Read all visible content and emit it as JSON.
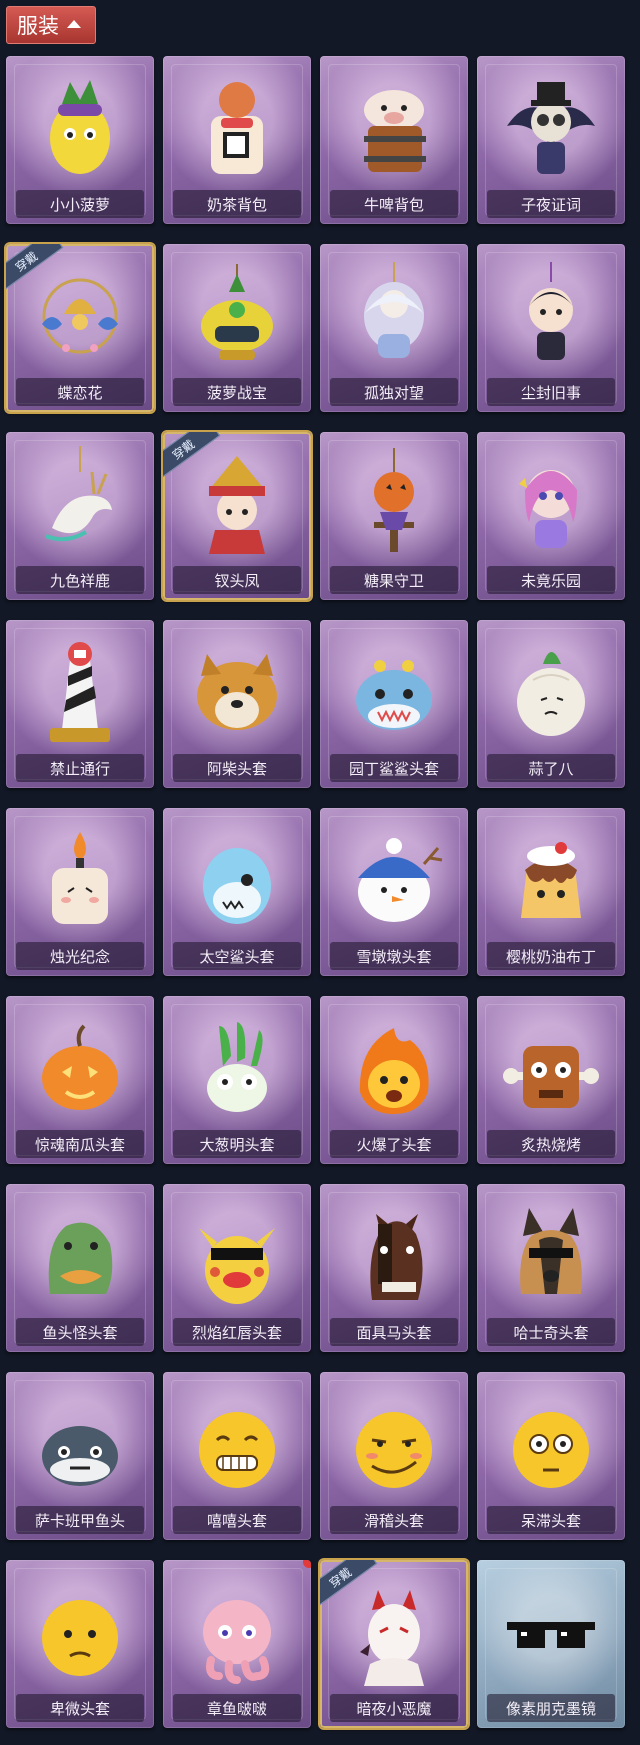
{
  "header": {
    "tab_label": "服装",
    "tab_icon": "chevron-up-icon"
  },
  "equipped_badge": "穿戴",
  "items": [
    {
      "label": "小小菠萝",
      "icon": "pineapple-figure-icon",
      "equipped": false
    },
    {
      "label": "奶茶背包",
      "icon": "milk-tea-backpack-icon",
      "equipped": false
    },
    {
      "label": "牛啤背包",
      "icon": "cow-beer-backpack-icon",
      "equipped": false
    },
    {
      "label": "子夜证词",
      "icon": "midnight-owl-icon",
      "equipped": false
    },
    {
      "label": "蝶恋花",
      "icon": "butterfly-flower-charm-icon",
      "equipped": true
    },
    {
      "label": "菠萝战宝",
      "icon": "pineapple-robot-icon",
      "equipped": false
    },
    {
      "label": "孤独对望",
      "icon": "lonely-gaze-charm-icon",
      "equipped": false
    },
    {
      "label": "尘封旧事",
      "icon": "boy-figure-charm-icon",
      "equipped": false
    },
    {
      "label": "九色祥鹿",
      "icon": "deer-charm-icon",
      "equipped": false
    },
    {
      "label": "钗头凤",
      "icon": "phoenix-crown-doll-icon",
      "equipped": true
    },
    {
      "label": "糖果守卫",
      "icon": "pumpkin-scarecrow-icon",
      "equipped": false
    },
    {
      "label": "未竟乐园",
      "icon": "pink-girl-charm-icon",
      "equipped": false
    },
    {
      "label": "禁止通行",
      "icon": "traffic-cone-icon",
      "equipped": false
    },
    {
      "label": "阿柴头套",
      "icon": "shiba-head-icon",
      "equipped": false
    },
    {
      "label": "园丁鲨鲨头套",
      "icon": "shark-gardener-head-icon",
      "equipped": false
    },
    {
      "label": "蒜了八",
      "icon": "garlic-head-icon",
      "equipped": false
    },
    {
      "label": "烛光纪念",
      "icon": "candle-head-icon",
      "equipped": false
    },
    {
      "label": "太空鲨头套",
      "icon": "space-shark-head-icon",
      "equipped": false
    },
    {
      "label": "雪墩墩头套",
      "icon": "snowman-head-icon",
      "equipped": false
    },
    {
      "label": "樱桃奶油布丁",
      "icon": "pudding-head-icon",
      "equipped": false
    },
    {
      "label": "惊魂南瓜头套",
      "icon": "pumpkin-head-icon",
      "equipped": false
    },
    {
      "label": "大葱明头套",
      "icon": "scallion-head-icon",
      "equipped": false
    },
    {
      "label": "火爆了头套",
      "icon": "fire-head-icon",
      "equipped": false
    },
    {
      "label": "炙热烧烤",
      "icon": "bbq-meat-head-icon",
      "equipped": false
    },
    {
      "label": "鱼头怪头套",
      "icon": "fish-monster-head-icon",
      "equipped": false
    },
    {
      "label": "烈焰红唇头套",
      "icon": "red-lips-head-icon",
      "equipped": false
    },
    {
      "label": "面具马头套",
      "icon": "horse-mask-head-icon",
      "equipped": false
    },
    {
      "label": "哈士奇头套",
      "icon": "husky-head-icon",
      "equipped": false
    },
    {
      "label": "萨卡班甲鱼头",
      "icon": "armored-fish-head-icon",
      "equipped": false
    },
    {
      "label": "嘻嘻头套",
      "icon": "grin-emoji-head-icon",
      "equipped": false
    },
    {
      "label": "滑稽头套",
      "icon": "smirk-emoji-head-icon",
      "equipped": false
    },
    {
      "label": "呆滞头套",
      "icon": "dazed-emoji-head-icon",
      "equipped": false
    },
    {
      "label": "卑微头套",
      "icon": "humble-emoji-head-icon",
      "equipped": false
    },
    {
      "label": "章鱼啵啵",
      "icon": "octopus-head-icon",
      "equipped": false,
      "new_dot": true
    },
    {
      "label": "暗夜小恶魔",
      "icon": "little-devil-icon",
      "equipped": true
    },
    {
      "label": "像素朋克墨镜",
      "icon": "pixel-sunglasses-icon",
      "equipped": false,
      "special": true
    }
  ]
}
